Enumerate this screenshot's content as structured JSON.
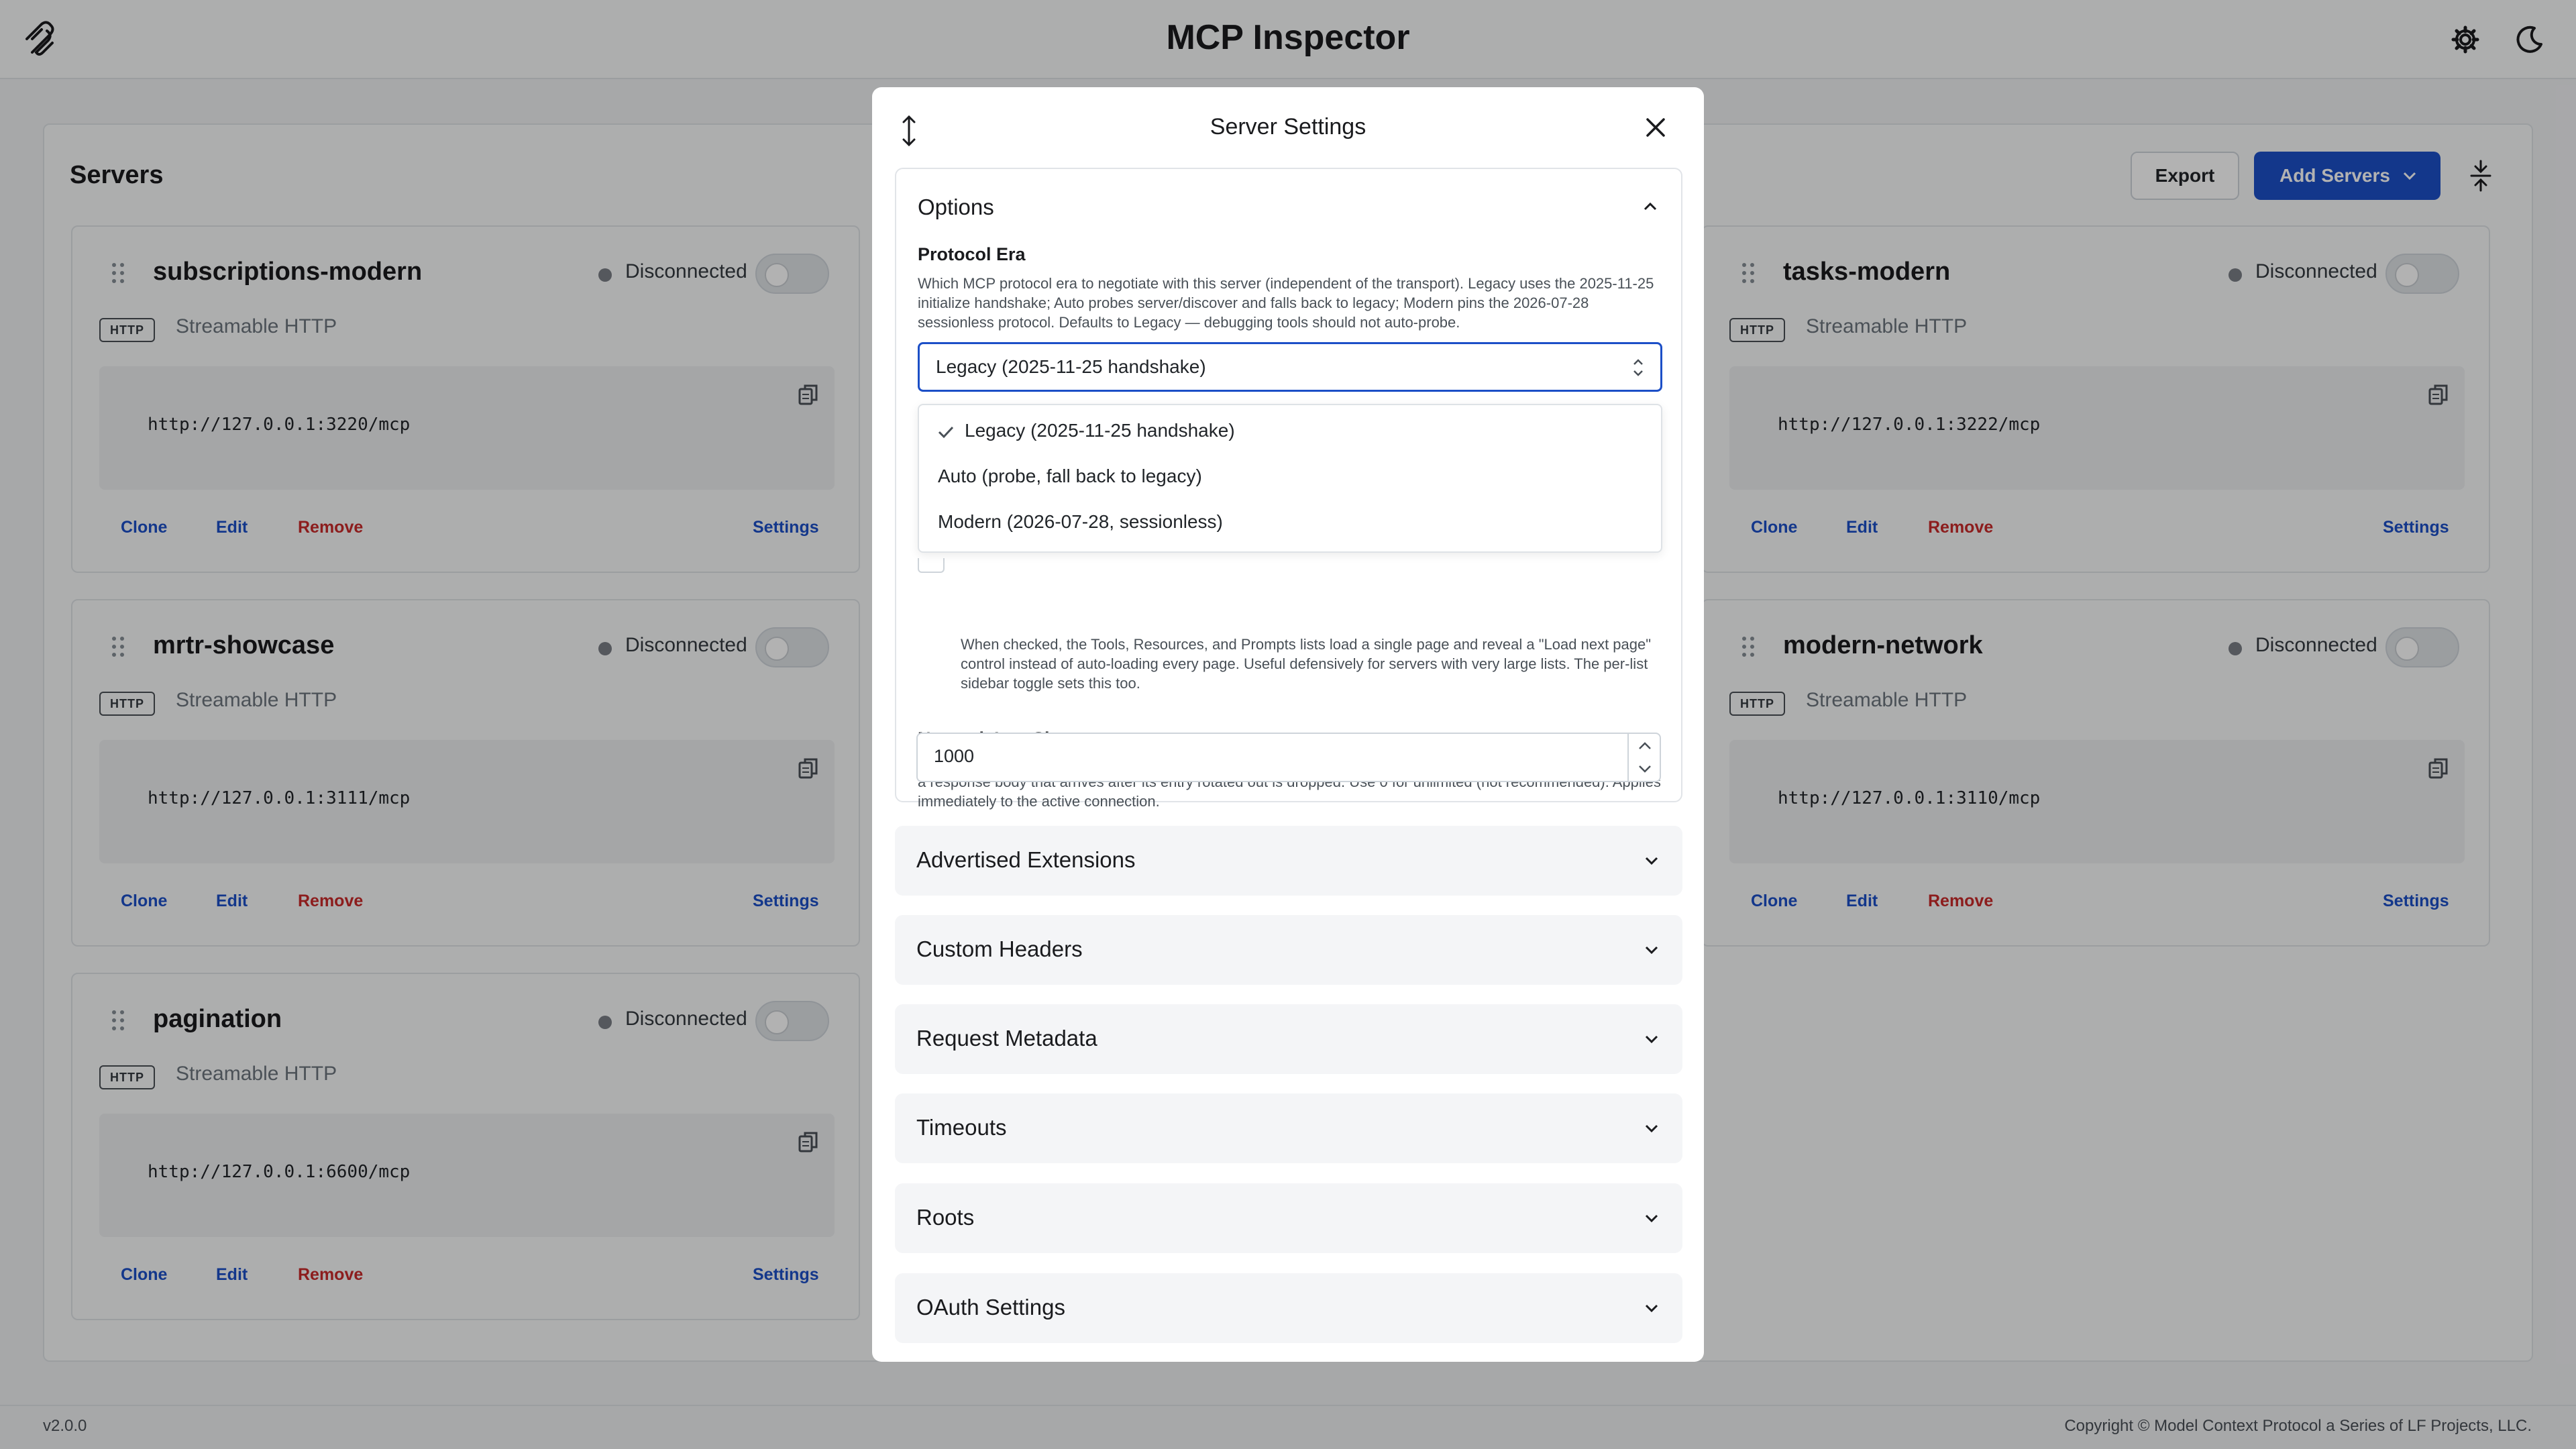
{
  "app": {
    "title": "MCP Inspector",
    "version": "v2.0.0",
    "copyright": "Copyright © Model Context Protocol a Series of LF Projects, LLC."
  },
  "header": {
    "settings_icon": "gear-icon",
    "theme_icon": "moon-icon"
  },
  "servers": {
    "title": "Servers",
    "export_label": "Export",
    "add_label": "Add Servers",
    "cards": [
      {
        "name": "subscriptions-modern",
        "status": "Disconnected",
        "badge": "HTTP",
        "transport": "Streamable HTTP",
        "url": "http://127.0.0.1:3220/mcp",
        "clone": "Clone",
        "edit": "Edit",
        "remove": "Remove",
        "settings": "Settings"
      },
      {
        "name": "tasks-modern",
        "status": "Disconnected",
        "badge": "HTTP",
        "transport": "Streamable HTTP",
        "url": "http://127.0.0.1:3222/mcp",
        "clone": "Clone",
        "edit": "Edit",
        "remove": "Remove",
        "settings": "Settings"
      },
      {
        "name": "mrtr-showcase",
        "status": "Disconnected",
        "badge": "HTTP",
        "transport": "Streamable HTTP",
        "url": "http://127.0.0.1:3111/mcp",
        "clone": "Clone",
        "edit": "Edit",
        "remove": "Remove",
        "settings": "Settings"
      },
      {
        "name": "modern-network",
        "status": "Disconnected",
        "badge": "HTTP",
        "transport": "Streamable HTTP",
        "url": "http://127.0.0.1:3110/mcp",
        "clone": "Clone",
        "edit": "Edit",
        "remove": "Remove",
        "settings": "Settings"
      },
      {
        "name": "pagination",
        "status": "Disconnected",
        "badge": "HTTP",
        "transport": "Streamable HTTP",
        "url": "http://127.0.0.1:6600/mcp",
        "clone": "Clone",
        "edit": "Edit",
        "remove": "Remove",
        "settings": "Settings"
      }
    ]
  },
  "modal": {
    "title": "Server Settings",
    "options": {
      "title": "Options",
      "protocol_era": {
        "label": "Protocol Era",
        "description": "Which MCP protocol era to negotiate with this server (independent of the transport). Legacy uses the 2025-11-25 initialize handshake; Auto probes server/discover and falls back to legacy; Modern pins the 2026-07-28 sessionless protocol. Defaults to Legacy — debugging tools should not auto-probe.",
        "selected": "Legacy (2025-11-25 handshake)",
        "options": [
          "Legacy (2025-11-25 handshake)",
          "Auto (probe, fall back to legacy)",
          "Modern (2026-07-28, sessionless)"
        ]
      },
      "pagination_description": "When checked, the Tools, Resources, and Prompts lists load a single page and reveal a \"Load next page\" control instead of auto-loading every page. Useful defensively for servers with very large lists. The per-list sidebar toggle sets this too.",
      "network_log": {
        "label": "Network Log Size",
        "description": "Maximum number of HTTP requests kept in the Network log for this server. Older entries rotate out past this limit; a response body that arrives after its entry rotated out is dropped. Use 0 for unlimited (not recommended). Applies immediately to the active connection.",
        "value": "1000"
      }
    },
    "sections": [
      "Advertised Extensions",
      "Custom Headers",
      "Request Metadata",
      "Timeouts",
      "Roots",
      "OAuth Settings"
    ]
  }
}
